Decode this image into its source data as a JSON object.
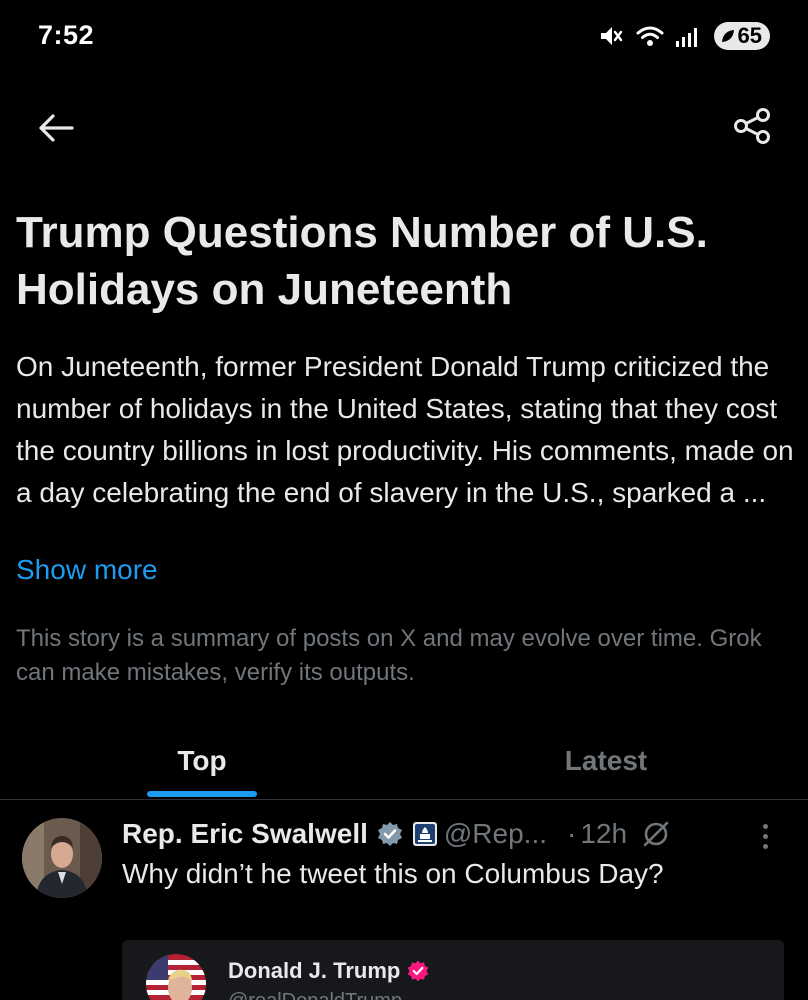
{
  "status_bar": {
    "time": "7:52",
    "battery": "65",
    "icons": [
      "silent-icon",
      "wifi-icon",
      "signal-icon",
      "battery-icon"
    ]
  },
  "nav": {
    "back_icon": "arrow-left-icon",
    "share_icon": "share-icon"
  },
  "story": {
    "title": "Trump Questions Number of U.S. Holidays on Juneteenth",
    "body": "On Juneteenth, former President Donald Trump criticized the number of holidays in the United States, stating that they cost the country billions in lost productivity. His comments, made on a day celebrating the end of slavery in the U.S., sparked a ...",
    "show_more": "Show more",
    "disclaimer": "This story is a summary of posts on X and may evolve over time. Grok can make mistakes, verify its outputs."
  },
  "tabs": [
    {
      "label": "Top",
      "active": true
    },
    {
      "label": "Latest",
      "active": false
    }
  ],
  "post": {
    "author": "Rep. Eric Swalwell",
    "handle": "@Rep...",
    "separator": "·",
    "time": "12h",
    "text": "Why didn’t he tweet this on Columbus Day?",
    "embedded": {
      "author": "Donald J. Trump",
      "handle": "@realDonaldTrump"
    }
  },
  "colors": {
    "background": "#000000",
    "text": "#e7e9ea",
    "muted": "#71767b",
    "accent": "#1d9bf0",
    "divider": "#2f3336"
  }
}
